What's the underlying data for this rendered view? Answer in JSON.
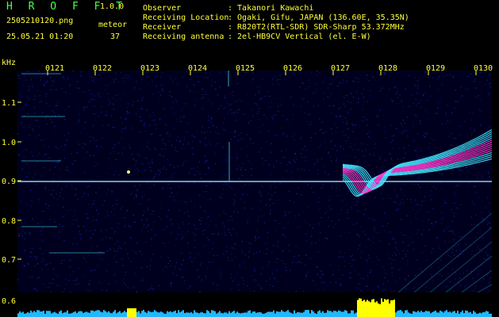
{
  "app": {
    "name": "H R O F F T",
    "version": "1.0.0"
  },
  "file": {
    "name": "2505210120.png",
    "datetime": "25.05.21 01:20"
  },
  "meteor": {
    "label": "meteor",
    "count": "37"
  },
  "station": [
    {
      "label": "Observer",
      "value": ": Takanori Kawachi"
    },
    {
      "label": "Receiving Location",
      "value": ": Ogaki, Gifu, JAPAN (136.60E, 35.35N)"
    },
    {
      "label": "Receiver",
      "value": ": R820T2(RTL-SDR) SDR-Sharp 53.372MHz"
    },
    {
      "label": "Receiving antenna",
      "value": ": 2el-HB9CV Vertical (el. E-W)"
    }
  ],
  "spectrogram": {
    "y_unit": "kHz",
    "y_ticks": [
      "1.1",
      "1.0",
      "0.9",
      "0.8",
      "0.7",
      "0.6"
    ],
    "time_ticks": [
      "0121",
      "0122",
      "0123",
      "0124",
      "0125",
      "0126",
      "0127",
      "0128",
      "0129",
      "0130"
    ],
    "colors": {
      "background": "#00001e",
      "noise": "#1a2fd0",
      "trace": "#43e6ff",
      "peak": "#ff3ad0",
      "carrier": "#9fe7ff",
      "strip": "#20b8ff",
      "burst": "#ffff00"
    }
  }
}
